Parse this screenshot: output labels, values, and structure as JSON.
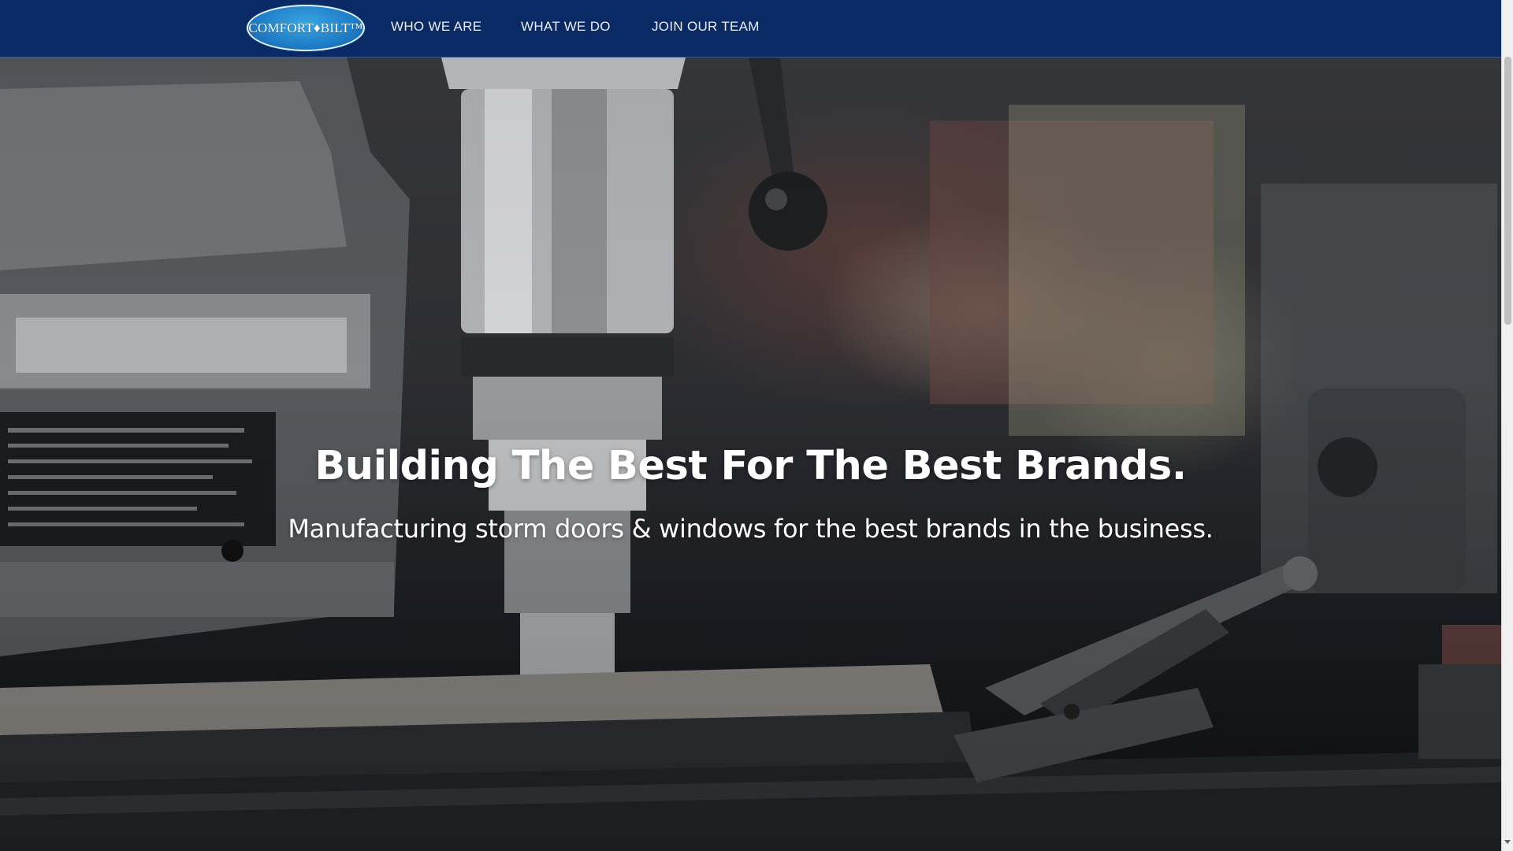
{
  "header": {
    "logo_text": "COMFORT♦BILT™",
    "nav": [
      {
        "label": "WHO WE ARE"
      },
      {
        "label": "WHAT WE DO"
      },
      {
        "label": "JOIN OUR TEAM"
      }
    ],
    "background_color": "#0a2a66"
  },
  "hero": {
    "title": "Building The Best For The Best Brands.",
    "subtitle": "Manufacturing storm doors & windows for the best brands in the business.",
    "background_image": "drill-press-machinery-icon"
  }
}
